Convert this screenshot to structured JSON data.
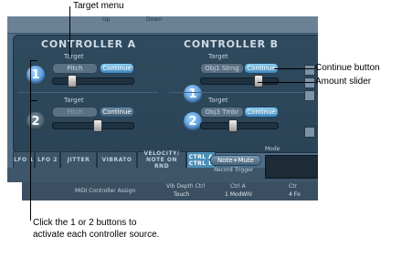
{
  "callouts": {
    "target_menu": "Target menu",
    "continue_button": "Continue button",
    "amount_slider": "Amount slider",
    "bottom_note": "Click the 1 or 2 buttons to activate each controller source."
  },
  "topbar": {
    "up": "Up",
    "down": "Down"
  },
  "controller_a": {
    "title": "CONTROLLER A",
    "row1": {
      "number": "1",
      "target_label": "Target",
      "target_value": "Pitch",
      "continue": "Continue"
    },
    "row2": {
      "number": "2",
      "target_label": "Target",
      "target_value": "Pitch",
      "continue": "Continue"
    }
  },
  "controller_b": {
    "title": "CONTROLLER B",
    "row1": {
      "number": "1",
      "target_label": "Target",
      "target_value": "Obj1 Strng",
      "continue": "Continue"
    },
    "row2": {
      "number": "2",
      "target_label": "Target",
      "target_value": "Obj3 Tmbr",
      "continue": "Continue"
    }
  },
  "tabs": [
    "LFO 1",
    "LFO 2",
    "JITTER",
    "VIBRATO",
    "VELOCITY/ NOTE ON RND",
    "CTRL A CTRL B"
  ],
  "lower": {
    "mode": "Mode",
    "note_mute": "Note+Mute",
    "record_trigger": "Record Trigger",
    "midi_assign": "MIDI Controller Assign",
    "vib_depth_label": "Vib Depth Ctrl",
    "vib_depth_value": "Touch",
    "ctrl_a_label": "Ctrl A",
    "ctrl_a_value": "1 ModWhl",
    "ctrl_b_label": "Ctr",
    "ctrl_b_value": "4 Fo"
  },
  "colors": {
    "panel": "#506d86",
    "accent": "#4c8fb8",
    "button_on": "#2f78c2"
  }
}
